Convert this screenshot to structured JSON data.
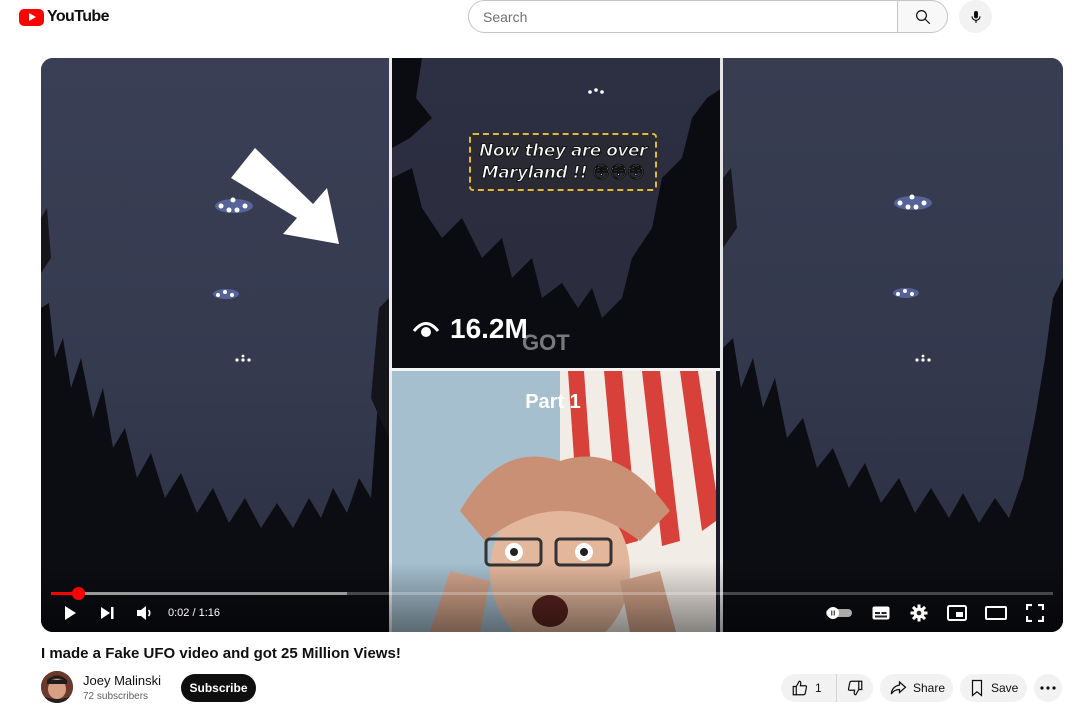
{
  "header": {
    "logo_text": "YouTube",
    "search_placeholder": "Search",
    "icons": {
      "search": "search-icon",
      "mic": "mic-icon",
      "logo": "youtube-play-icon"
    }
  },
  "player": {
    "overlay": {
      "caption_line1": "Now they are over",
      "caption_line2": "Maryland !! 😳😳😳",
      "views": "16.2M",
      "got": "GOT",
      "part": "Part 1"
    },
    "time_current": "0:02",
    "time_separator": " / ",
    "time_duration": "1:16",
    "progress_fraction": 0.027,
    "buffer_fraction": 0.295,
    "accent_color": "#ff0000"
  },
  "video": {
    "title": "I made a Fake UFO video and got 25 Million Views!",
    "channel_name": "Joey Malinski",
    "subscribers": "72 subscribers",
    "subscribe_label": "Subscribe",
    "like_count": "1",
    "share_label": "Share",
    "save_label": "Save"
  }
}
